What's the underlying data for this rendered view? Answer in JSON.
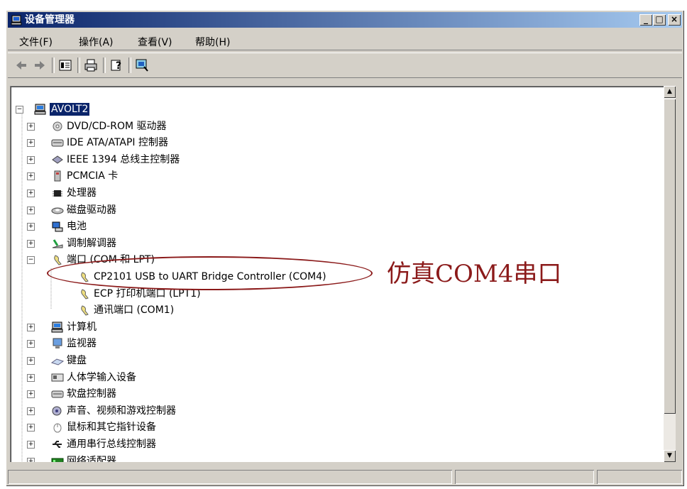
{
  "window": {
    "title": "设备管理器",
    "controls": {
      "minimize": "_",
      "maximize": "□",
      "close": "×"
    }
  },
  "menu": {
    "items": [
      "文件(F)",
      "操作(A)",
      "查看(V)",
      "帮助(H)"
    ]
  },
  "toolbar": {
    "icons": [
      "back-icon",
      "forward-icon",
      "properties-icon",
      "print-icon",
      "help-icon",
      "scan-hardware-icon"
    ]
  },
  "tree": {
    "root": "AVOLT2",
    "items": [
      {
        "label": "DVD/CD-ROM 驱动器",
        "icon": "cdrom-icon",
        "expanded": false
      },
      {
        "label": "IDE ATA/ATAPI 控制器",
        "icon": "ide-icon",
        "expanded": false
      },
      {
        "label": "IEEE 1394 总线主控制器",
        "icon": "ieee1394-icon",
        "expanded": false
      },
      {
        "label": "PCMCIA 卡",
        "icon": "pcmcia-icon",
        "expanded": false
      },
      {
        "label": "处理器",
        "icon": "cpu-icon",
        "expanded": false
      },
      {
        "label": "磁盘驱动器",
        "icon": "disk-icon",
        "expanded": false
      },
      {
        "label": "电池",
        "icon": "battery-icon",
        "expanded": false
      },
      {
        "label": "调制解调器",
        "icon": "modem-icon",
        "expanded": false
      },
      {
        "label": "端口 (COM 和 LPT)",
        "icon": "port-icon",
        "expanded": true,
        "children": [
          {
            "label": "CP2101 USB to UART Bridge Controller (COM4)",
            "icon": "port-icon"
          },
          {
            "label": "ECP 打印机端口 (LPT1)",
            "icon": "port-icon"
          },
          {
            "label": "通讯端口 (COM1)",
            "icon": "port-icon"
          }
        ]
      },
      {
        "label": "计算机",
        "icon": "computer-icon",
        "expanded": false
      },
      {
        "label": "监视器",
        "icon": "monitor-icon",
        "expanded": false
      },
      {
        "label": "键盘",
        "icon": "keyboard-icon",
        "expanded": false
      },
      {
        "label": "人体学输入设备",
        "icon": "hid-icon",
        "expanded": false
      },
      {
        "label": "软盘控制器",
        "icon": "floppy-icon",
        "expanded": false
      },
      {
        "label": "声音、视频和游戏控制器",
        "icon": "sound-icon",
        "expanded": false
      },
      {
        "label": "鼠标和其它指针设备",
        "icon": "mouse-icon",
        "expanded": false
      },
      {
        "label": "通用串行总线控制器",
        "icon": "usb-icon",
        "expanded": false
      },
      {
        "label": "网络适配器",
        "icon": "network-icon",
        "expanded": false
      }
    ]
  },
  "annotation": {
    "text": "仿真COM4串口",
    "color": "#8b1a1a"
  },
  "colors": {
    "titlebar_start": "#0a246a",
    "titlebar_end": "#a6caf0",
    "chrome": "#d4d0c8",
    "selection": "#0a246a"
  }
}
